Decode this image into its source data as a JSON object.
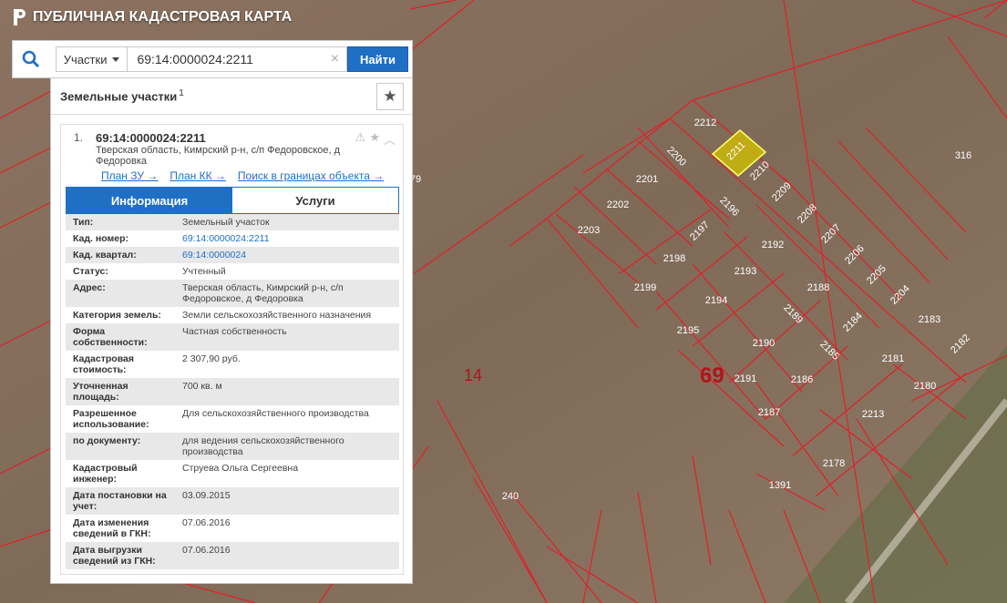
{
  "app": {
    "title": "ПУБЛИЧНАЯ КАДАСТРОВАЯ КАРТА"
  },
  "search": {
    "type_label": "Участки",
    "query": "69:14:0000024:2211",
    "find_label": "Найти",
    "clear": "×"
  },
  "panel": {
    "title": "Земельные участки",
    "count": "1"
  },
  "result": {
    "index": "1.",
    "cadnum": "69:14:0000024:2211",
    "address": "Тверская область, Кимрский р-н, с/п Федоровское, д Федоровка",
    "links": [
      "План ЗУ →",
      "План КК →",
      "Поиск в границах объекта →"
    ],
    "tabs": [
      "Информация",
      "Услуги"
    ],
    "rows": [
      {
        "k": "Тип:",
        "v": "Земельный участок",
        "link": false
      },
      {
        "k": "Кад. номер:",
        "v": "69:14:0000024:2211",
        "link": true
      },
      {
        "k": "Кад. квартал:",
        "v": "69:14:0000024",
        "link": true
      },
      {
        "k": "Статус:",
        "v": "Учтенный",
        "link": false
      },
      {
        "k": "Адрес:",
        "v": "Тверская область, Кимрский р-н, с/п Федоровское, д Федоровка",
        "link": false
      },
      {
        "k": "Категория земель:",
        "v": "Земли сельскохозяйственного назначения",
        "link": false
      },
      {
        "k": "Форма собственности:",
        "v": "Частная собственность",
        "link": false
      },
      {
        "k": "Кадастровая стоимость:",
        "v": "2 307,90 руб.",
        "link": false
      },
      {
        "k": "Уточненная площадь:",
        "v": "700 кв. м",
        "link": false
      },
      {
        "k": "Разрешенное использование:",
        "v": "Для сельскохозяйственного производства",
        "link": false
      },
      {
        "k": "по документу:",
        "v": "для ведения сельскохозяйственного производства",
        "link": false
      },
      {
        "k": "Кадастровый инженер:",
        "v": "Струева Ольга Сергеевна",
        "link": false
      },
      {
        "k": "Дата постановки на учет:",
        "v": "03.09.2015",
        "link": false
      },
      {
        "k": "Дата изменения сведений в ГКН:",
        "v": "07.06.2016",
        "link": false
      },
      {
        "k": "Дата выгрузки сведений из ГКН:",
        "v": "07.06.2016",
        "link": false
      }
    ]
  },
  "map": {
    "district_labels": [
      "14",
      "69"
    ],
    "parcel_labels": [
      "2212",
      "2211",
      "2200",
      "2201",
      "2210",
      "2209",
      "2202",
      "2196",
      "2208",
      "2203",
      "2197",
      "2207",
      "2192",
      "2206",
      "2198",
      "2193",
      "2205",
      "2199",
      "2194",
      "2188",
      "2204",
      "2195",
      "2189",
      "2184",
      "2183",
      "2190",
      "2185",
      "2182",
      "2191",
      "2186",
      "2181",
      "2187",
      "2180",
      "2213",
      "2178",
      "1391",
      "316",
      "240",
      "79"
    ],
    "colors": {
      "boundary": "#e0202a",
      "selected": "#d4c400",
      "label": "#ffffff"
    }
  }
}
